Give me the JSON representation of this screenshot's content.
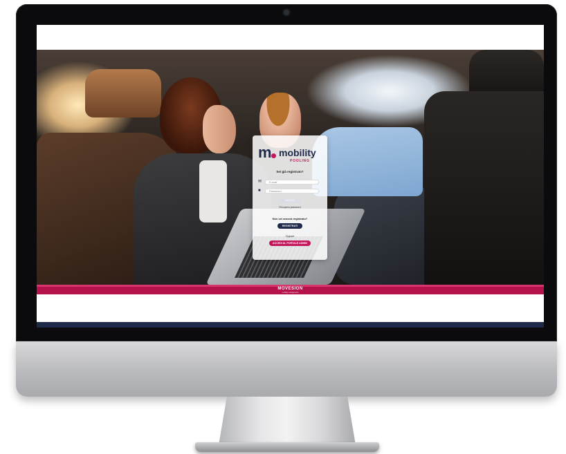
{
  "colors": {
    "brand_navy": "#1f2a4a",
    "brand_magenta": "#c2185b",
    "footer_bar": "#b5124c"
  },
  "logo": {
    "mark": "m",
    "word": "mobility",
    "sub": "POOLING"
  },
  "login": {
    "prompt": "Sei già registrato?",
    "email_placeholder": "E-mail",
    "email_icon": "envelope-icon",
    "password_placeholder": "Password",
    "password_icon": "lock-icon",
    "login_button": "ACCEDI",
    "forgot_link": "Recupera password",
    "not_registered": "Non sei ancora registrato?",
    "register_button": "REGISTRATI",
    "or_text": "Oppure",
    "admin_button": "ACCEDI AL PORTALE ADMIN"
  },
  "footer": {
    "brand": "MOVESION",
    "brand_sub": "mobility management"
  }
}
